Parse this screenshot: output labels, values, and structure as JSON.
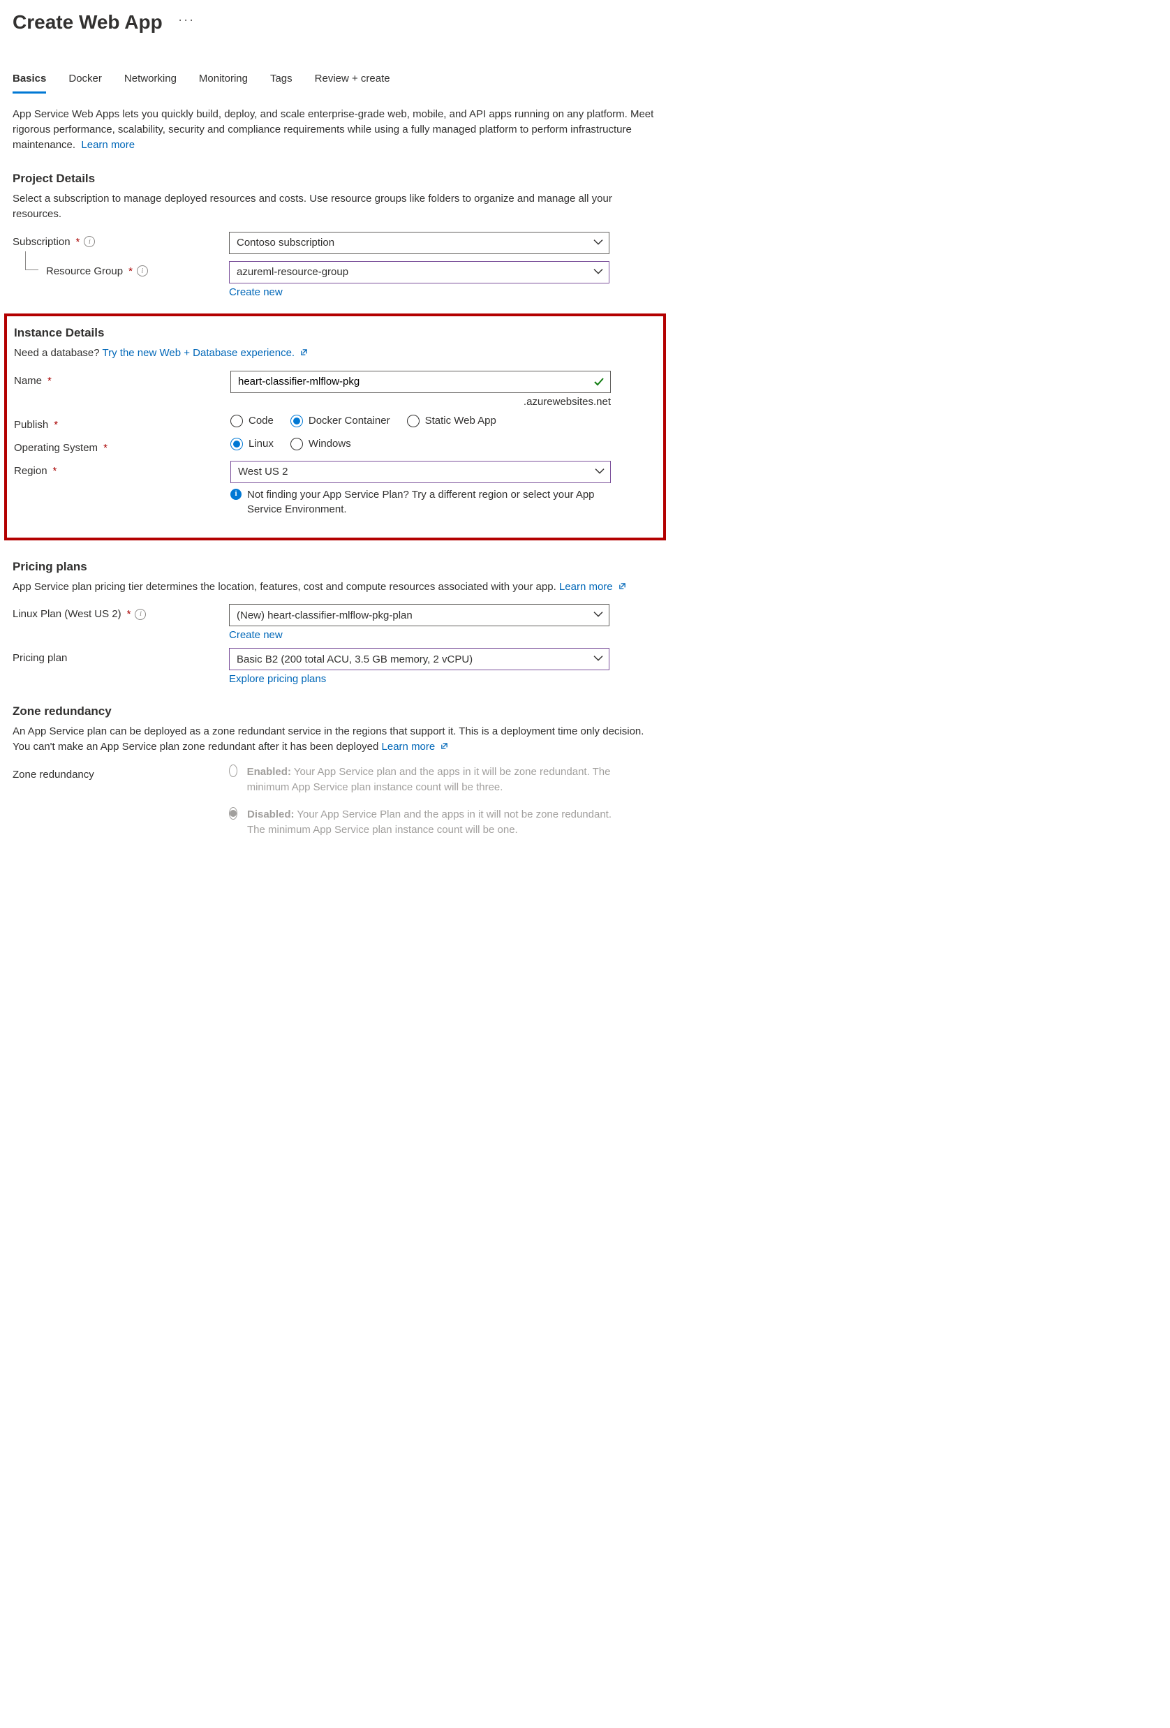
{
  "pageTitle": "Create Web App",
  "tabs": [
    "Basics",
    "Docker",
    "Networking",
    "Monitoring",
    "Tags",
    "Review + create"
  ],
  "activeTab": "Basics",
  "intro": "App Service Web Apps lets you quickly build, deploy, and scale enterprise-grade web, mobile, and API apps running on any platform. Meet rigorous performance, scalability, security and compliance requirements while using a fully managed platform to perform infrastructure maintenance.",
  "learnMore": "Learn more",
  "projectDetails": {
    "title": "Project Details",
    "desc": "Select a subscription to manage deployed resources and costs. Use resource groups like folders to organize and manage all your resources.",
    "subscriptionLabel": "Subscription",
    "subscriptionValue": "Contoso subscription",
    "resourceGroupLabel": "Resource Group",
    "resourceGroupValue": "azureml-resource-group",
    "createNew": "Create new"
  },
  "instanceDetails": {
    "title": "Instance Details",
    "dbPrompt": "Need a database?",
    "dbLink": "Try the new Web + Database experience.",
    "nameLabel": "Name",
    "nameValue": "heart-classifier-mlflow-pkg",
    "domainSuffix": ".azurewebsites.net",
    "publishLabel": "Publish",
    "publishOptions": [
      "Code",
      "Docker Container",
      "Static Web App"
    ],
    "publishSelected": "Docker Container",
    "osLabel": "Operating System",
    "osOptions": [
      "Linux",
      "Windows"
    ],
    "osSelected": "Linux",
    "regionLabel": "Region",
    "regionValue": "West US 2",
    "regionNote": "Not finding your App Service Plan? Try a different region or select your App Service Environment."
  },
  "pricingPlans": {
    "title": "Pricing plans",
    "desc": "App Service plan pricing tier determines the location, features, cost and compute resources associated with your app.",
    "learnMore": "Learn more",
    "planLabel": "Linux Plan (West US 2)",
    "planValue": "(New) heart-classifier-mlflow-pkg-plan",
    "createNew": "Create new",
    "pricingPlanLabel": "Pricing plan",
    "pricingPlanValue": "Basic B2 (200 total ACU, 3.5 GB memory, 2 vCPU)",
    "exploreLink": "Explore pricing plans"
  },
  "zoneRedundancy": {
    "title": "Zone redundancy",
    "desc": "An App Service plan can be deployed as a zone redundant service in the regions that support it. This is a deployment time only decision. You can't make an App Service plan zone redundant after it has been deployed",
    "learnMore": "Learn more",
    "label": "Zone redundancy",
    "enabledTitle": "Enabled:",
    "enabledDesc": "Your App Service plan and the apps in it will be zone redundant. The minimum App Service plan instance count will be three.",
    "disabledTitle": "Disabled:",
    "disabledDesc": "Your App Service Plan and the apps in it will not be zone redundant. The minimum App Service plan instance count will be one.",
    "selected": "Disabled"
  }
}
